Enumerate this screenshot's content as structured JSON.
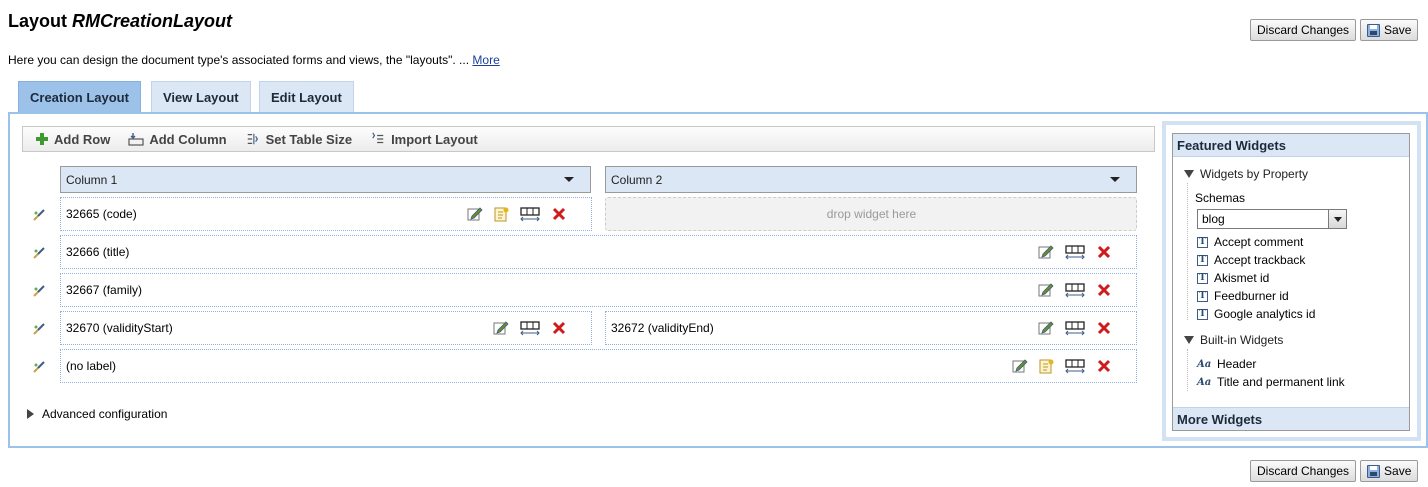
{
  "header": {
    "title_prefix": "Layout",
    "title_name": "RMCreationLayout",
    "description": "Here you can design the document type's associated forms and views, the \"layouts\". ...",
    "more_link": "More"
  },
  "actions": {
    "discard_label": "Discard Changes",
    "save_label": "Save"
  },
  "tabs": [
    {
      "label": "Creation Layout",
      "active": true
    },
    {
      "label": "View Layout",
      "active": false
    },
    {
      "label": "Edit Layout",
      "active": false
    }
  ],
  "toolbar": {
    "add_row": "Add Row",
    "add_column": "Add Column",
    "set_table_size": "Set Table Size",
    "import_layout": "Import Layout"
  },
  "columns": [
    {
      "label": "Column 1"
    },
    {
      "label": "Column 2"
    }
  ],
  "rows": [
    {
      "cells": [
        {
          "label": "32665 (code)"
        },
        {
          "label": "drop widget here",
          "drop_zone": true
        }
      ]
    },
    {
      "cells": [
        {
          "label": "32666 (title)"
        }
      ]
    },
    {
      "cells": [
        {
          "label": "32667 (family)"
        }
      ]
    },
    {
      "cells": [
        {
          "label": "32670 (validityStart)"
        },
        {
          "label": "32672 (validityEnd)"
        }
      ]
    },
    {
      "cells": [
        {
          "label": "(no label)"
        }
      ]
    }
  ],
  "advanced": {
    "label": "Advanced configuration"
  },
  "widgets_panel": {
    "title": "Featured Widgets",
    "by_property": {
      "label": "Widgets by Property",
      "schemas_label": "Schemas",
      "schema_selected": "blog",
      "items": [
        "Accept comment",
        "Accept trackback",
        "Akismet id",
        "Feedburner id",
        "Google analytics id"
      ]
    },
    "builtin": {
      "label": "Built-in Widgets",
      "items": [
        "Header",
        "Title and permanent link"
      ]
    },
    "more_label": "More Widgets"
  },
  "colors": {
    "tab_active": "#9cc2ea",
    "tab_inactive": "#dbe7f5",
    "panel_border": "#9cc2ea",
    "delete_red": "#d11a1a"
  }
}
